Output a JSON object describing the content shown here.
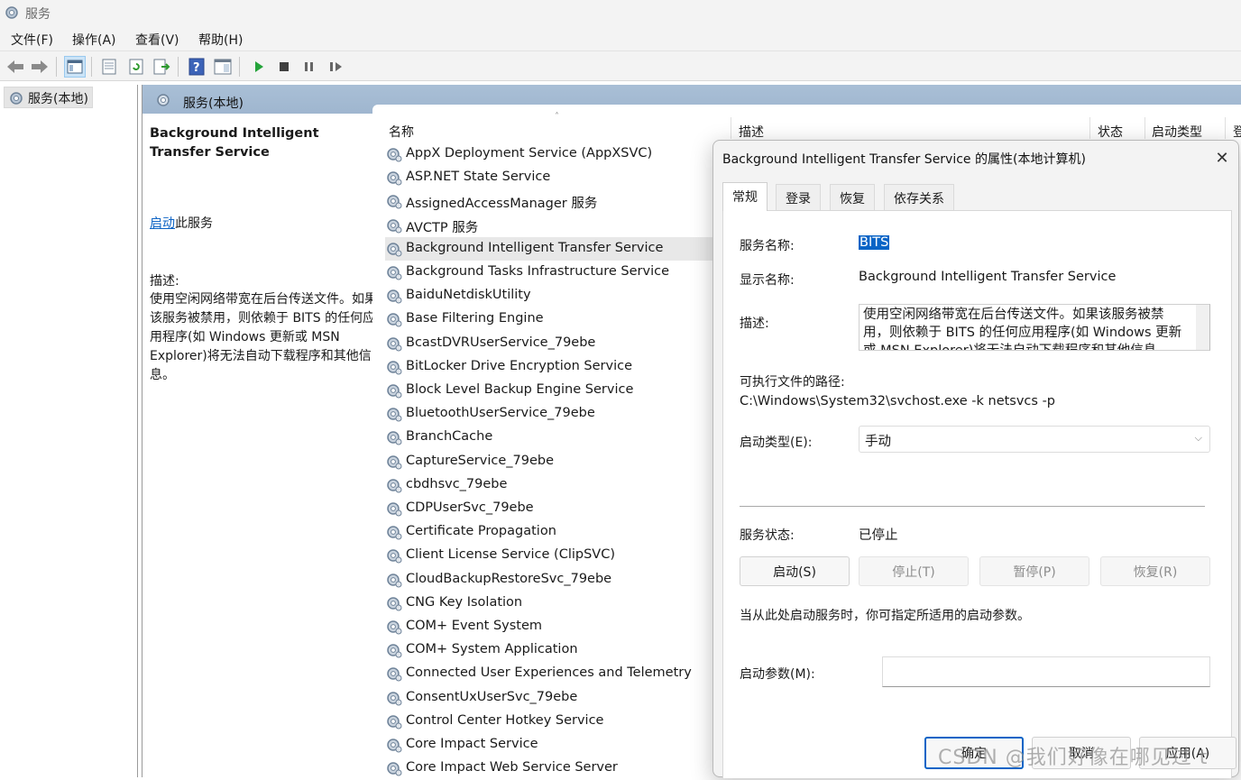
{
  "window": {
    "title": "服务"
  },
  "menu": [
    "文件(F)",
    "操作(A)",
    "查看(V)",
    "帮助(H)"
  ],
  "tree": {
    "root": "服务(本地)"
  },
  "main": {
    "header": "服务(本地)",
    "desc_pane": {
      "title": "Background Intelligent Transfer Service",
      "action_link": "启动",
      "action_suffix": "此服务",
      "desc_label": "描述:",
      "desc_text": "使用空闲网络带宽在后台传送文件。如果该服务被禁用，则依赖于 BITS 的任何应用程序(如 Windows 更新或 MSN Explorer)将无法自动下载程序和其他信息。"
    },
    "columns": {
      "name": "名称",
      "description": "描述",
      "status": "状态",
      "startup": "启动类型",
      "logon": "登"
    },
    "services": [
      "AppX Deployment Service (AppXSVC)",
      "ASP.NET State Service",
      "AssignedAccessManager 服务",
      "AVCTP 服务",
      "Background Intelligent Transfer Service",
      "Background Tasks Infrastructure Service",
      "BaiduNetdiskUtility",
      "Base Filtering Engine",
      "BcastDVRUserService_79ebe",
      "BitLocker Drive Encryption Service",
      "Block Level Backup Engine Service",
      "BluetoothUserService_79ebe",
      "BranchCache",
      "CaptureService_79ebe",
      "cbdhsvc_79ebe",
      "CDPUserSvc_79ebe",
      "Certificate Propagation",
      "Client License Service (ClipSVC)",
      "CloudBackupRestoreSvc_79ebe",
      "CNG Key Isolation",
      "COM+ Event System",
      "COM+ System Application",
      "Connected User Experiences and Telemetry",
      "ConsentUxUserSvc_79ebe",
      "Control Center Hotkey Service",
      "Core Impact Service",
      "Core Impact Web Service Server"
    ],
    "selected_index": 4
  },
  "dialog": {
    "title": "Background Intelligent Transfer Service 的属性(本地计算机)",
    "tabs": [
      "常规",
      "登录",
      "恢复",
      "依存关系"
    ],
    "active_tab": 0,
    "service_name_label": "服务名称:",
    "service_name": "BITS",
    "display_name_label": "显示名称:",
    "display_name": "Background Intelligent Transfer Service",
    "description_label": "描述:",
    "description": "使用空闲网络带宽在后台传送文件。如果该服务被禁用，则依赖于 BITS 的任何应用程序(如 Windows 更新或 MSN Explorer)将无法自动下载程序和其他信息。",
    "path_label": "可执行文件的路径:",
    "path": "C:\\Windows\\System32\\svchost.exe -k netsvcs -p",
    "startup_type_label": "启动类型(E):",
    "startup_type": "手动",
    "status_label": "服务状态:",
    "status": "已停止",
    "buttons": {
      "start": "启动(S)",
      "stop": "停止(T)",
      "pause": "暂停(P)",
      "resume": "恢复(R)"
    },
    "hint": "当从此处启动服务时，你可指定所适用的启动参数。",
    "param_label": "启动参数(M):",
    "param_value": "",
    "footer": {
      "ok": "确定",
      "cancel": "取消",
      "apply": "应用(A)"
    }
  },
  "watermark": "CSDN @我们好像在哪见过 t"
}
